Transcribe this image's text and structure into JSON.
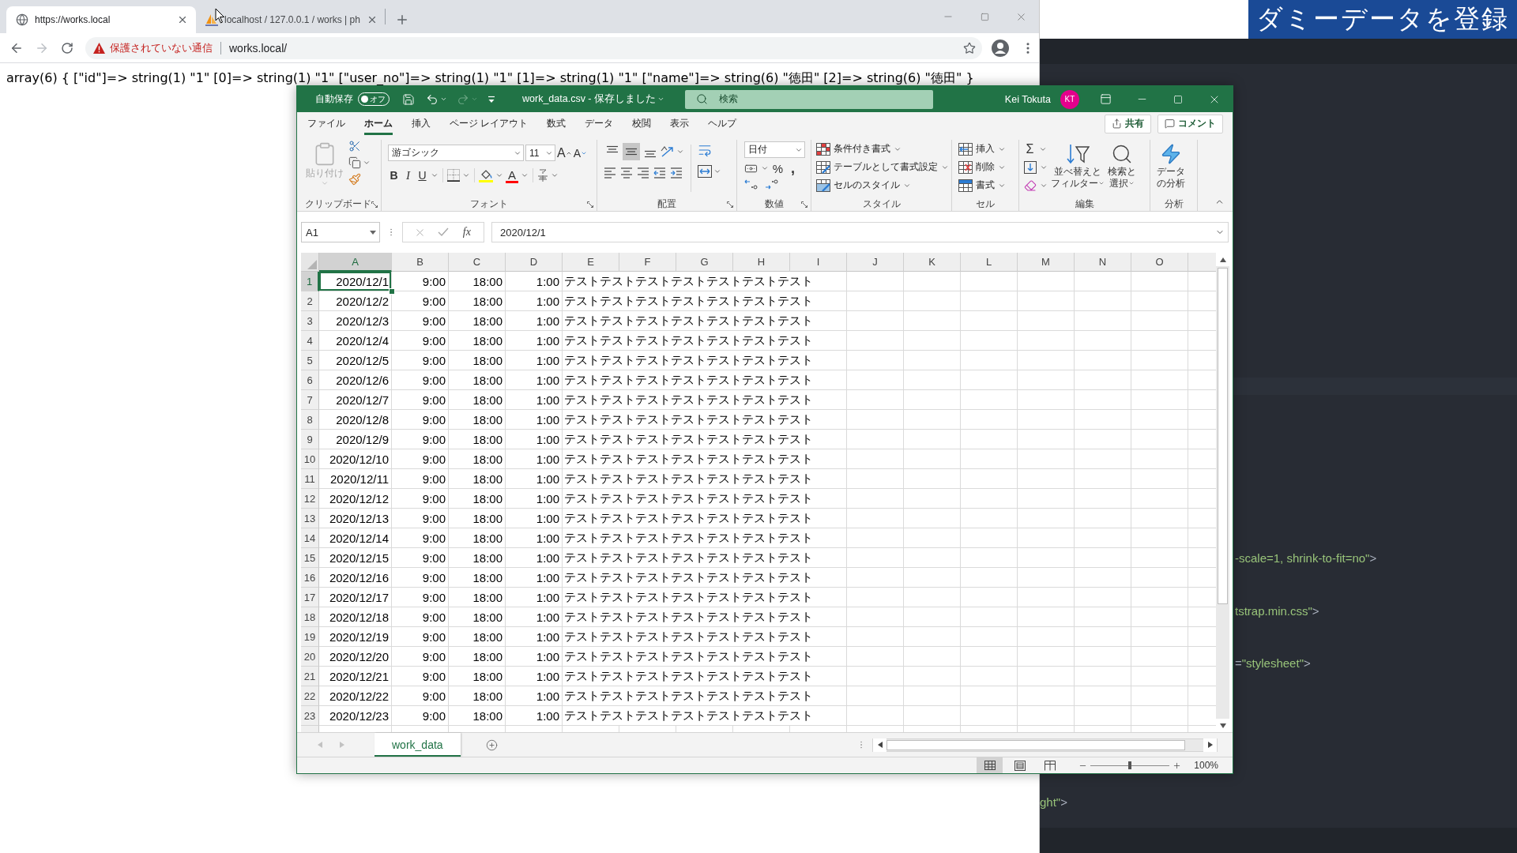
{
  "browser": {
    "tabs": [
      {
        "title": "https://works.local",
        "selected": true
      },
      {
        "title": "localhost / 127.0.0.1 / works | ph",
        "selected": false
      }
    ],
    "forward_disabled": true,
    "security_label": "保護されていない通信",
    "url": "works.local/",
    "page_text": "array(6) { [\"id\"]=> string(1) \"1\" [0]=> string(1) \"1\" [\"user_no\"]=> string(1) \"1\" [1]=> string(1) \"1\" [\"name\"]=> string(6) \"徳田\" [2]=> string(6) \"徳田\" }"
  },
  "caption": "ダミーデータを登録",
  "editor": {
    "lines": [
      {
        "segments": [
          {
            "text": "-scale=1, shrink-to-fit=no\"",
            "kind": "string"
          },
          {
            "text": ">",
            "kind": "punct"
          }
        ]
      },
      {
        "segments": [
          {
            "text": "tstrap.min.css\"",
            "kind": "string"
          },
          {
            "text": ">",
            "kind": "punct"
          }
        ]
      },
      {
        "segments": [
          {
            "text": "=",
            "kind": "punct"
          },
          {
            "text": "\"stylesheet\"",
            "kind": "string"
          },
          {
            "text": ">",
            "kind": "punct"
          }
        ]
      },
      {
        "segments": [
          {
            "text": "ght\"",
            "kind": "string"
          },
          {
            "text": ">",
            "kind": "punct"
          }
        ]
      }
    ]
  },
  "excel": {
    "autosave": {
      "label": "自動保存",
      "state_text": "オフ",
      "on": false
    },
    "quick_access": {
      "redo_disabled": true
    },
    "file_title": "work_data.csv - 保存しました",
    "search_placeholder": "検索",
    "user_name": "Kei Tokuta",
    "user_initials": "KT",
    "ribbon_tabs": [
      {
        "label": "ファイル",
        "selected": false
      },
      {
        "label": "ホーム",
        "selected": true
      },
      {
        "label": "挿入",
        "selected": false
      },
      {
        "label": "ページ レイアウト",
        "selected": false
      },
      {
        "label": "数式",
        "selected": false
      },
      {
        "label": "データ",
        "selected": false
      },
      {
        "label": "校閲",
        "selected": false
      },
      {
        "label": "表示",
        "selected": false
      },
      {
        "label": "ヘルプ",
        "selected": false
      }
    ],
    "share": "共有",
    "comment": "コメント",
    "clipboard": {
      "label": "クリップボード",
      "paste": "貼り付け",
      "paste_disabled": true
    },
    "font": {
      "label": "フォント",
      "name": "游ゴシック",
      "size": "11",
      "grow": "A",
      "shrink": "A",
      "bold": "B",
      "italic": "I",
      "underline": "U",
      "color_letter": "A"
    },
    "alignment": {
      "label": "配置",
      "valign": [
        {
          "kind": "top",
          "selected": false
        },
        {
          "kind": "middle",
          "selected": true
        },
        {
          "kind": "bottom",
          "selected": false
        }
      ]
    },
    "number": {
      "label": "数値",
      "format": "日付",
      "percent": "%",
      "comma": ","
    },
    "styles": {
      "label": "スタイル",
      "items": [
        {
          "kind": "conditional",
          "label": "条件付き書式"
        },
        {
          "kind": "table",
          "label": "テーブルとして書式設定"
        },
        {
          "kind": "cell",
          "label": "セルのスタイル"
        }
      ]
    },
    "cells": {
      "label": "セル",
      "items": [
        {
          "kind": "insert",
          "label": "挿入"
        },
        {
          "kind": "delete",
          "label": "削除"
        },
        {
          "kind": "format",
          "label": "書式"
        }
      ]
    },
    "editing": {
      "label": "編集",
      "sum": "Σ",
      "sort": [
        "並べ替えと",
        "フィルター"
      ],
      "find": [
        "検索と",
        "選択"
      ]
    },
    "analysis": {
      "label": "分析",
      "lines": [
        "データ",
        "の分析"
      ]
    },
    "formula_bar": {
      "name_box": "A1",
      "function_label": "fx",
      "value": "2020/12/1",
      "editing": false
    },
    "columns": [
      {
        "label": "A",
        "selected": true
      },
      {
        "label": "B",
        "selected": false
      },
      {
        "label": "C",
        "selected": false
      },
      {
        "label": "D",
        "selected": false
      },
      {
        "label": "E",
        "selected": false
      },
      {
        "label": "F",
        "selected": false
      },
      {
        "label": "G",
        "selected": false
      },
      {
        "label": "H",
        "selected": false
      },
      {
        "label": "I",
        "selected": false
      },
      {
        "label": "J",
        "selected": false
      },
      {
        "label": "K",
        "selected": false
      },
      {
        "label": "L",
        "selected": false
      },
      {
        "label": "M",
        "selected": false
      },
      {
        "label": "N",
        "selected": false
      },
      {
        "label": "O",
        "selected": false
      }
    ],
    "rows": [
      {
        "number": "1",
        "selected": true,
        "cells": [
          "2020/12/1",
          "9:00",
          "18:00",
          "1:00",
          "テストテストテストテストテストテストテスト"
        ]
      },
      {
        "number": "2",
        "selected": false,
        "cells": [
          "2020/12/2",
          "9:00",
          "18:00",
          "1:00",
          "テストテストテストテストテストテストテスト"
        ]
      },
      {
        "number": "3",
        "selected": false,
        "cells": [
          "2020/12/3",
          "9:00",
          "18:00",
          "1:00",
          "テストテストテストテストテストテストテスト"
        ]
      },
      {
        "number": "4",
        "selected": false,
        "cells": [
          "2020/12/4",
          "9:00",
          "18:00",
          "1:00",
          "テストテストテストテストテストテストテスト"
        ]
      },
      {
        "number": "5",
        "selected": false,
        "cells": [
          "2020/12/5",
          "9:00",
          "18:00",
          "1:00",
          "テストテストテストテストテストテストテスト"
        ]
      },
      {
        "number": "6",
        "selected": false,
        "cells": [
          "2020/12/6",
          "9:00",
          "18:00",
          "1:00",
          "テストテストテストテストテストテストテスト"
        ]
      },
      {
        "number": "7",
        "selected": false,
        "cells": [
          "2020/12/7",
          "9:00",
          "18:00",
          "1:00",
          "テストテストテストテストテストテストテスト"
        ]
      },
      {
        "number": "8",
        "selected": false,
        "cells": [
          "2020/12/8",
          "9:00",
          "18:00",
          "1:00",
          "テストテストテストテストテストテストテスト"
        ]
      },
      {
        "number": "9",
        "selected": false,
        "cells": [
          "2020/12/9",
          "9:00",
          "18:00",
          "1:00",
          "テストテストテストテストテストテストテスト"
        ]
      },
      {
        "number": "10",
        "selected": false,
        "cells": [
          "2020/12/10",
          "9:00",
          "18:00",
          "1:00",
          "テストテストテストテストテストテストテスト"
        ]
      },
      {
        "number": "11",
        "selected": false,
        "cells": [
          "2020/12/11",
          "9:00",
          "18:00",
          "1:00",
          "テストテストテストテストテストテストテスト"
        ]
      },
      {
        "number": "12",
        "selected": false,
        "cells": [
          "2020/12/12",
          "9:00",
          "18:00",
          "1:00",
          "テストテストテストテストテストテストテスト"
        ]
      },
      {
        "number": "13",
        "selected": false,
        "cells": [
          "2020/12/13",
          "9:00",
          "18:00",
          "1:00",
          "テストテストテストテストテストテストテスト"
        ]
      },
      {
        "number": "14",
        "selected": false,
        "cells": [
          "2020/12/14",
          "9:00",
          "18:00",
          "1:00",
          "テストテストテストテストテストテストテスト"
        ]
      },
      {
        "number": "15",
        "selected": false,
        "cells": [
          "2020/12/15",
          "9:00",
          "18:00",
          "1:00",
          "テストテストテストテストテストテストテスト"
        ]
      },
      {
        "number": "16",
        "selected": false,
        "cells": [
          "2020/12/16",
          "9:00",
          "18:00",
          "1:00",
          "テストテストテストテストテストテストテスト"
        ]
      },
      {
        "number": "17",
        "selected": false,
        "cells": [
          "2020/12/17",
          "9:00",
          "18:00",
          "1:00",
          "テストテストテストテストテストテストテスト"
        ]
      },
      {
        "number": "18",
        "selected": false,
        "cells": [
          "2020/12/18",
          "9:00",
          "18:00",
          "1:00",
          "テストテストテストテストテストテストテスト"
        ]
      },
      {
        "number": "19",
        "selected": false,
        "cells": [
          "2020/12/19",
          "9:00",
          "18:00",
          "1:00",
          "テストテストテストテストテストテストテスト"
        ]
      },
      {
        "number": "20",
        "selected": false,
        "cells": [
          "2020/12/20",
          "9:00",
          "18:00",
          "1:00",
          "テストテストテストテストテストテストテスト"
        ]
      },
      {
        "number": "21",
        "selected": false,
        "cells": [
          "2020/12/21",
          "9:00",
          "18:00",
          "1:00",
          "テストテストテストテストテストテストテスト"
        ]
      },
      {
        "number": "22",
        "selected": false,
        "cells": [
          "2020/12/22",
          "9:00",
          "18:00",
          "1:00",
          "テストテストテストテストテストテストテスト"
        ]
      },
      {
        "number": "23",
        "selected": false,
        "cells": [
          "2020/12/23",
          "9:00",
          "18:00",
          "1:00",
          "テストテストテストテストテストテストテスト"
        ]
      }
    ],
    "sheets": [
      {
        "name": "work_data",
        "selected": true
      }
    ],
    "sheet_nav_disabled": true,
    "views": [
      {
        "kind": "normal",
        "selected": true
      },
      {
        "kind": "page_layout",
        "selected": false
      },
      {
        "kind": "page_break",
        "selected": false
      }
    ],
    "zoom": {
      "level": 0.5,
      "reading": "100%"
    }
  }
}
